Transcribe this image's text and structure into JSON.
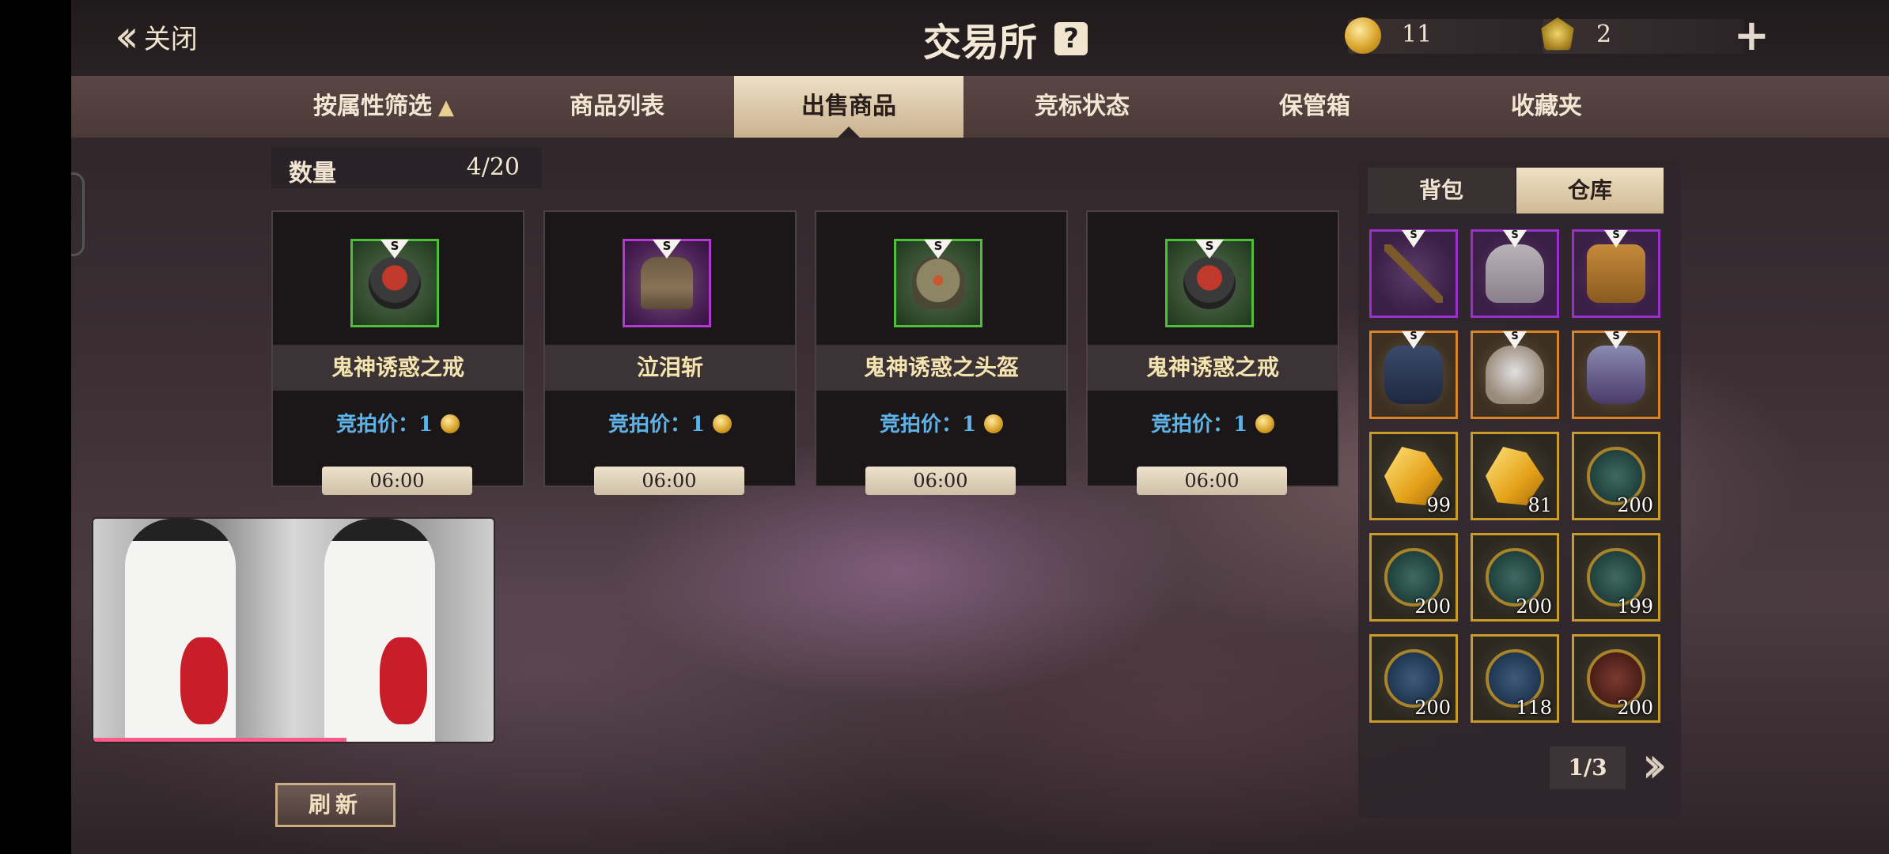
{
  "header": {
    "close_label": "关闭",
    "title": "交易所",
    "help_icon": "question-icon",
    "currencies": [
      {
        "icon": "gold-coin-icon",
        "value": "11"
      },
      {
        "icon": "gem-icon",
        "value": "2"
      }
    ]
  },
  "tabs": [
    {
      "label": "按属性筛选",
      "indicator": "▲"
    },
    {
      "label": "商品列表"
    },
    {
      "label": "出售商品",
      "active": true
    },
    {
      "label": "竞标状态"
    },
    {
      "label": "保管箱"
    },
    {
      "label": "收藏夹"
    }
  ],
  "quantity": {
    "label": "数量",
    "value": "4/20"
  },
  "listings": [
    {
      "name": "鬼神诱惑之戒",
      "grade": "S",
      "rarity_color": "#4fbf3a",
      "price_label": "竞拍价：1",
      "timer": "06:00"
    },
    {
      "name": "泣泪斩",
      "grade": "S",
      "rarity_color": "#b23ad0",
      "price_label": "竞拍价：1",
      "timer": "06:00"
    },
    {
      "name": "鬼神诱惑之头盔",
      "grade": "S",
      "rarity_color": "#4fbf3a",
      "price_label": "竞拍价：1",
      "timer": "06:00"
    },
    {
      "name": "鬼神诱惑之戒",
      "grade": "S",
      "rarity_color": "#4fbf3a",
      "price_label": "竞拍价：1",
      "timer": "06:00"
    }
  ],
  "refresh_label": "刷新",
  "inventory": {
    "tabs": [
      "背包",
      "仓库"
    ],
    "active_tab": "仓库",
    "items": [
      {
        "grade": "S",
        "rarity": "purple",
        "count": ""
      },
      {
        "grade": "S",
        "rarity": "purple",
        "count": ""
      },
      {
        "grade": "S",
        "rarity": "purple",
        "count": ""
      },
      {
        "grade": "S",
        "rarity": "orange",
        "count": ""
      },
      {
        "grade": "S",
        "rarity": "orange",
        "count": ""
      },
      {
        "grade": "S",
        "rarity": "orange",
        "count": ""
      },
      {
        "grade": "",
        "rarity": "gold",
        "count": "99"
      },
      {
        "grade": "",
        "rarity": "gold",
        "count": "81"
      },
      {
        "grade": "",
        "rarity": "gold",
        "count": "200"
      },
      {
        "grade": "",
        "rarity": "gold",
        "count": "200"
      },
      {
        "grade": "",
        "rarity": "gold",
        "count": "200"
      },
      {
        "grade": "",
        "rarity": "gold",
        "count": "199"
      },
      {
        "grade": "",
        "rarity": "gold",
        "count": "200"
      },
      {
        "grade": "",
        "rarity": "gold",
        "count": "118"
      },
      {
        "grade": "",
        "rarity": "gold",
        "count": "200"
      }
    ],
    "page": "1/3"
  }
}
